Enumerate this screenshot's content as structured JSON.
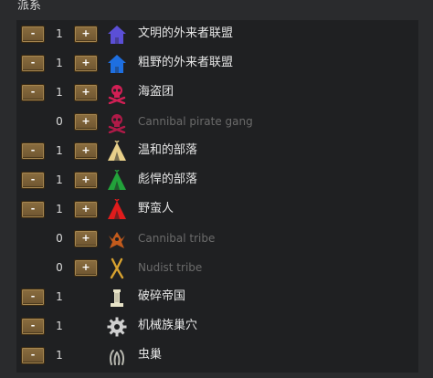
{
  "header": {
    "title": "派系"
  },
  "controls": {
    "minus": "-",
    "plus": "+"
  },
  "rows": [
    {
      "count": "1",
      "label": "文明的外来者联盟",
      "icon": "house-icon",
      "color": "#5b4fd6",
      "minus": true,
      "plus": true,
      "dim": false
    },
    {
      "count": "1",
      "label": "粗野的外来者联盟",
      "icon": "house-icon",
      "color": "#1e6fe0",
      "minus": true,
      "plus": true,
      "dim": false
    },
    {
      "count": "1",
      "label": "海盗团",
      "icon": "skull-icon",
      "color": "#d21f55",
      "minus": true,
      "plus": true,
      "dim": false
    },
    {
      "count": "0",
      "label": "Cannibal pirate gang",
      "icon": "skull-icon",
      "color": "#b01a48",
      "minus": false,
      "plus": true,
      "dim": true
    },
    {
      "count": "1",
      "label": "温和的部落",
      "icon": "tent-icon",
      "color": "#e8d08a",
      "minus": true,
      "plus": true,
      "dim": false
    },
    {
      "count": "1",
      "label": "彪悍的部落",
      "icon": "tent-icon",
      "color": "#22a23a",
      "minus": true,
      "plus": true,
      "dim": false
    },
    {
      "count": "1",
      "label": "野蛮人",
      "icon": "tent-icon",
      "color": "#e01c1c",
      "minus": true,
      "plus": true,
      "dim": false
    },
    {
      "count": "0",
      "label": "Cannibal tribe",
      "icon": "cannibal-tribe-icon",
      "color": "#c25a1c",
      "minus": false,
      "plus": true,
      "dim": true
    },
    {
      "count": "0",
      "label": "Nudist tribe",
      "icon": "nudist-tribe-icon",
      "color": "#d8a230",
      "minus": false,
      "plus": true,
      "dim": true
    },
    {
      "count": "1",
      "label": "破碎帝国",
      "icon": "pillar-icon",
      "color": "#e8e4c8",
      "minus": true,
      "plus": false,
      "dim": false
    },
    {
      "count": "1",
      "label": "机械族巢穴",
      "icon": "gear-icon",
      "color": "#d0d0d0",
      "minus": true,
      "plus": false,
      "dim": false
    },
    {
      "count": "1",
      "label": "虫巢",
      "icon": "insect-hive-icon",
      "color": "#b8b8b0",
      "minus": true,
      "plus": false,
      "dim": false
    }
  ]
}
